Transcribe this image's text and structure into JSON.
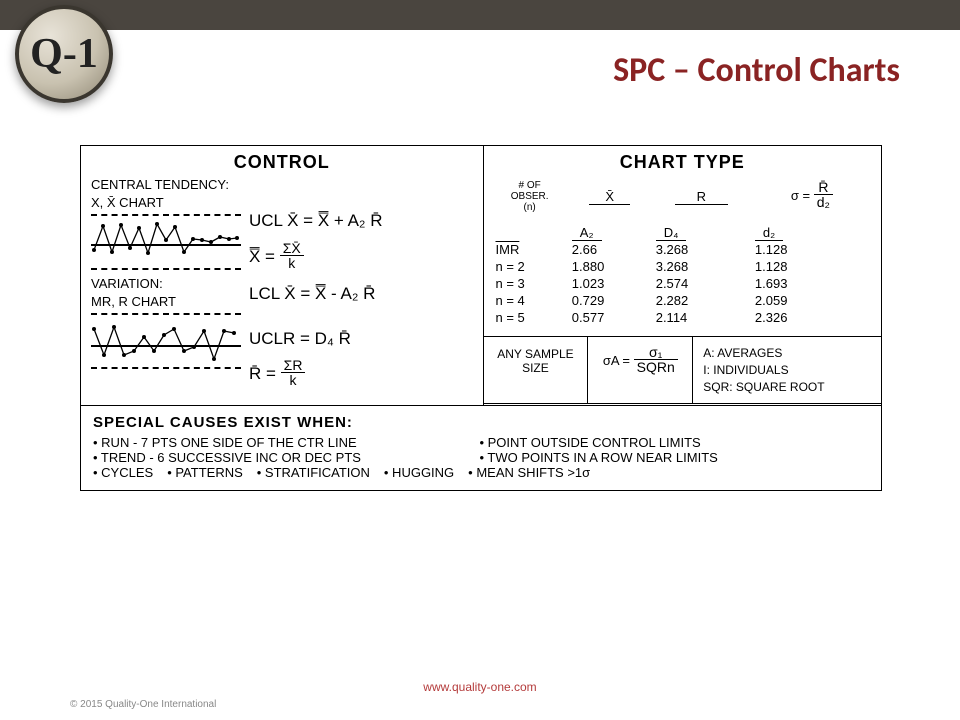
{
  "logo_text": "Q-1",
  "page_title": "SPC – Control Charts",
  "control": {
    "heading": "CONTROL",
    "central_label": "CENTRAL TENDENCY:",
    "central_chart": "X, X̄ CHART",
    "variation_label": "VARIATION:",
    "variation_chart": "MR, R CHART",
    "f_ucl_x": "UCL X̄ = X̿ + A₂ R̄",
    "f_xbb": "X̿ =",
    "f_xbb_num": "ΣX̄",
    "f_xbb_den": "k",
    "f_lcl_x": "LCL X̄ = X̿ - A₂ R̄",
    "f_ucl_r": "UCLR = D₄ R̄",
    "f_rbar": "R̄ =",
    "f_rbar_num": "ΣR",
    "f_rbar_den": "k"
  },
  "chart_type": {
    "heading": "CHART TYPE",
    "obs_label1": "# OF",
    "obs_label2": "OBSER.",
    "obs_label3": "(n)",
    "col_x": "X̄",
    "col_r": "R",
    "col_sigma": "σ =",
    "col_sigma_num": "R̄",
    "col_sigma_den": "d₂",
    "h_a2": "A₂",
    "h_d4": "D₄",
    "h_d2": "d₂",
    "rows": [
      {
        "n": "IMR",
        "a2": "2.66",
        "d4": "3.268",
        "d2": "1.128"
      },
      {
        "n": "n = 2",
        "a2": "1.880",
        "d4": "3.268",
        "d2": "1.128"
      },
      {
        "n": "n = 3",
        "a2": "1.023",
        "d4": "2.574",
        "d2": "1.693"
      },
      {
        "n": "n = 4",
        "a2": "0.729",
        "d4": "2.282",
        "d2": "2.059"
      },
      {
        "n": "n = 5",
        "a2": "0.577",
        "d4": "2.114",
        "d2": "2.326"
      }
    ]
  },
  "r2": {
    "any_sample": "ANY SAMPLE SIZE",
    "sigmaA": "σA =",
    "sigmaA_num": "σ₁",
    "sigmaA_den": "SQRn",
    "legend_a": "A: AVERAGES",
    "legend_i": "I: INDIVIDUALS",
    "legend_sqr": "SQR: SQUARE ROOT"
  },
  "causes": {
    "heading": "SPECIAL CAUSES EXIST WHEN:",
    "b1": "• RUN - 7 PTS ONE SIDE OF THE CTR LINE",
    "b2": "• POINT OUTSIDE CONTROL LIMITS",
    "b3": "• TREND - 6 SUCCESSIVE INC OR DEC PTS",
    "b4": "• TWO POINTS IN A ROW NEAR LIMITS",
    "b5": "• CYCLES",
    "b6": "• PATTERNS",
    "b7": "• STRATIFICATION",
    "b8": "• HUGGING",
    "b9": "• MEAN SHIFTS >1σ"
  },
  "footer_url": "www.quality-one.com",
  "copyright": "© 2015 Quality-One International",
  "chart_data": {
    "type": "line",
    "title": "Generic SPC control chart sketches",
    "series": [
      {
        "name": "X-bar chart",
        "values": [
          10,
          38,
          8,
          40,
          15,
          36,
          8,
          42,
          22,
          36,
          12,
          25,
          23,
          22,
          27,
          25,
          26,
          24
        ]
      },
      {
        "name": "R chart",
        "values": [
          32,
          6,
          34,
          6,
          10,
          24,
          10,
          26,
          32,
          10,
          14,
          30,
          2,
          30,
          28
        ]
      }
    ],
    "ylabel": "",
    "xlabel": "",
    "ylim": [
      0,
      44
    ]
  }
}
